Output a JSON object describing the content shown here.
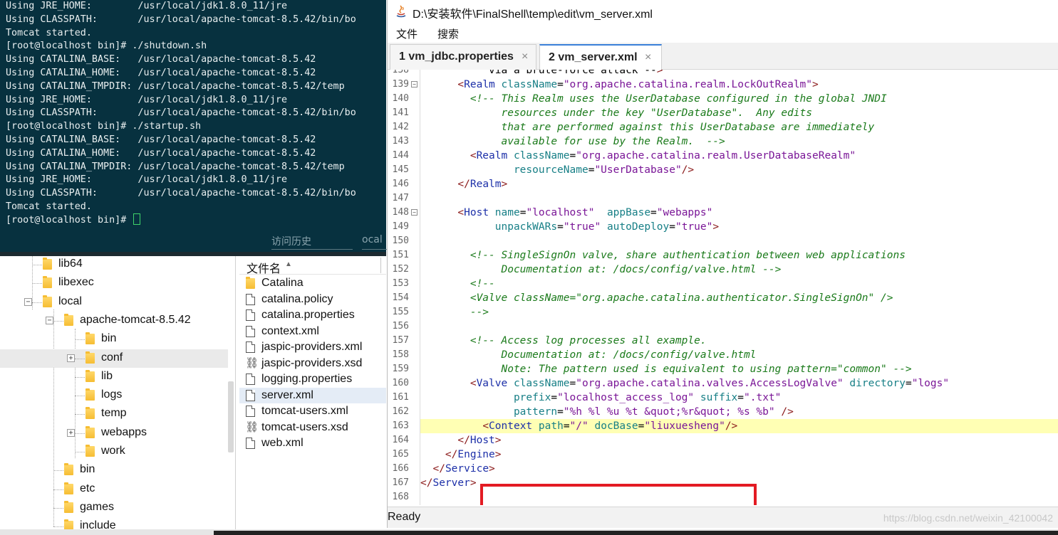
{
  "terminal": {
    "lines": [
      "Using JRE_HOME:        /usr/local/jdk1.8.0_11/jre",
      "Using CLASSPATH:       /usr/local/apache-tomcat-8.5.42/bin/bo",
      "Tomcat started.",
      "[root@localhost bin]# ./shutdown.sh",
      "Using CATALINA_BASE:   /usr/local/apache-tomcat-8.5.42",
      "Using CATALINA_HOME:   /usr/local/apache-tomcat-8.5.42",
      "Using CATALINA_TMPDIR: /usr/local/apache-tomcat-8.5.42/temp",
      "Using JRE_HOME:        /usr/local/jdk1.8.0_11/jre",
      "Using CLASSPATH:       /usr/local/apache-tomcat-8.5.42/bin/bo",
      "[root@localhost bin]# ./startup.sh",
      "Using CATALINA_BASE:   /usr/local/apache-tomcat-8.5.42",
      "Using CATALINA_HOME:   /usr/local/apache-tomcat-8.5.42",
      "Using CATALINA_TMPDIR: /usr/local/apache-tomcat-8.5.42/temp",
      "Using JRE_HOME:        /usr/local/jdk1.8.0_11/jre",
      "Using CLASSPATH:       /usr/local/apache-tomcat-8.5.42/bin/bo",
      "Tomcat started.",
      "[root@localhost bin]# "
    ],
    "history_label": "访问历史",
    "local_label": "ocal"
  },
  "folder_tree": {
    "items": [
      {
        "label": "lib64"
      },
      {
        "label": "libexec"
      },
      {
        "label": "local"
      },
      {
        "label": "apache-tomcat-8.5.42"
      },
      {
        "label": "bin"
      },
      {
        "label": "conf"
      },
      {
        "label": "lib"
      },
      {
        "label": "logs"
      },
      {
        "label": "temp"
      },
      {
        "label": "webapps"
      },
      {
        "label": "work"
      },
      {
        "label": "bin"
      },
      {
        "label": "etc"
      },
      {
        "label": "games"
      },
      {
        "label": "include"
      }
    ],
    "selected": "conf"
  },
  "file_list": {
    "header": "文件名",
    "files": [
      {
        "name": "Catalina",
        "kind": "folder"
      },
      {
        "name": "catalina.policy",
        "kind": "file"
      },
      {
        "name": "catalina.properties",
        "kind": "file"
      },
      {
        "name": "context.xml",
        "kind": "file"
      },
      {
        "name": "jaspic-providers.xml",
        "kind": "file"
      },
      {
        "name": "jaspic-providers.xsd",
        "kind": "xsd"
      },
      {
        "name": "logging.properties",
        "kind": "file"
      },
      {
        "name": "server.xml",
        "kind": "file"
      },
      {
        "name": "tomcat-users.xml",
        "kind": "file"
      },
      {
        "name": "tomcat-users.xsd",
        "kind": "xsd"
      },
      {
        "name": "web.xml",
        "kind": "file"
      }
    ],
    "selected": "server.xml"
  },
  "editor": {
    "title": "D:\\安装软件\\FinalShell\\temp\\edit\\vm_server.xml",
    "menus": [
      "文件",
      "搜索"
    ],
    "tabs": [
      {
        "label": "1  vm_jdbc.properties",
        "close": "×"
      },
      {
        "label": "2  vm_server.xml",
        "close": "×"
      }
    ],
    "active_tab": 1,
    "status": "Ready",
    "watermark": "https://blog.csdn.net/weixin_42100042",
    "current_line": "163",
    "lines": [
      {
        "n": "138",
        "text": "           via a brute-force attack -->",
        "fold": false
      },
      {
        "n": "139",
        "text": "      <Realm className=\"org.apache.catalina.realm.LockOutRealm\">",
        "fold": true
      },
      {
        "n": "140",
        "text": "        <!-- This Realm uses the UserDatabase configured in the global JNDI",
        "fold": false
      },
      {
        "n": "141",
        "text": "             resources under the key \"UserDatabase\".  Any edits",
        "fold": false
      },
      {
        "n": "142",
        "text": "             that are performed against this UserDatabase are immediately",
        "fold": false
      },
      {
        "n": "143",
        "text": "             available for use by the Realm.  -->",
        "fold": false
      },
      {
        "n": "144",
        "text": "        <Realm className=\"org.apache.catalina.realm.UserDatabaseRealm\"",
        "fold": false
      },
      {
        "n": "145",
        "text": "               resourceName=\"UserDatabase\"/>",
        "fold": false
      },
      {
        "n": "146",
        "text": "      </Realm>",
        "fold": false
      },
      {
        "n": "147",
        "text": "",
        "fold": false
      },
      {
        "n": "148",
        "text": "      <Host name=\"localhost\"  appBase=\"webapps\"",
        "fold": true
      },
      {
        "n": "149",
        "text": "            unpackWARs=\"true\" autoDeploy=\"true\">",
        "fold": false
      },
      {
        "n": "150",
        "text": "",
        "fold": false
      },
      {
        "n": "151",
        "text": "        <!-- SingleSignOn valve, share authentication between web applications",
        "fold": false
      },
      {
        "n": "152",
        "text": "             Documentation at: /docs/config/valve.html -->",
        "fold": false
      },
      {
        "n": "153",
        "text": "        <!--",
        "fold": false
      },
      {
        "n": "154",
        "text": "        <Valve className=\"org.apache.catalina.authenticator.SingleSignOn\" />",
        "fold": false
      },
      {
        "n": "155",
        "text": "        -->",
        "fold": false
      },
      {
        "n": "156",
        "text": "",
        "fold": false
      },
      {
        "n": "157",
        "text": "        <!-- Access log processes all example.",
        "fold": false
      },
      {
        "n": "158",
        "text": "             Documentation at: /docs/config/valve.html",
        "fold": false
      },
      {
        "n": "159",
        "text": "             Note: The pattern used is equivalent to using pattern=\"common\" -->",
        "fold": false
      },
      {
        "n": "160",
        "text": "        <Valve className=\"org.apache.catalina.valves.AccessLogValve\" directory=\"logs\"",
        "fold": false
      },
      {
        "n": "161",
        "text": "               prefix=\"localhost_access_log\" suffix=\".txt\"",
        "fold": false
      },
      {
        "n": "162",
        "text": "               pattern=\"%h %l %u %t &quot;%r&quot; %s %b\" />",
        "fold": false
      },
      {
        "n": "163",
        "text": "          <Context path=\"/\" docBase=\"liuxuesheng\"/>",
        "fold": false
      },
      {
        "n": "164",
        "text": "      </Host>",
        "fold": false
      },
      {
        "n": "165",
        "text": "    </Engine>",
        "fold": false
      },
      {
        "n": "166",
        "text": "  </Service>",
        "fold": false
      },
      {
        "n": "167",
        "text": "</Server>",
        "fold": false
      },
      {
        "n": "168",
        "text": "",
        "fold": false
      }
    ]
  },
  "colors": {
    "terminal_bg": "#07313f",
    "current_line_bg": "#ffffb4",
    "highlight_box": "#e31b23",
    "active_tab_accent": "#3a7fd8"
  }
}
